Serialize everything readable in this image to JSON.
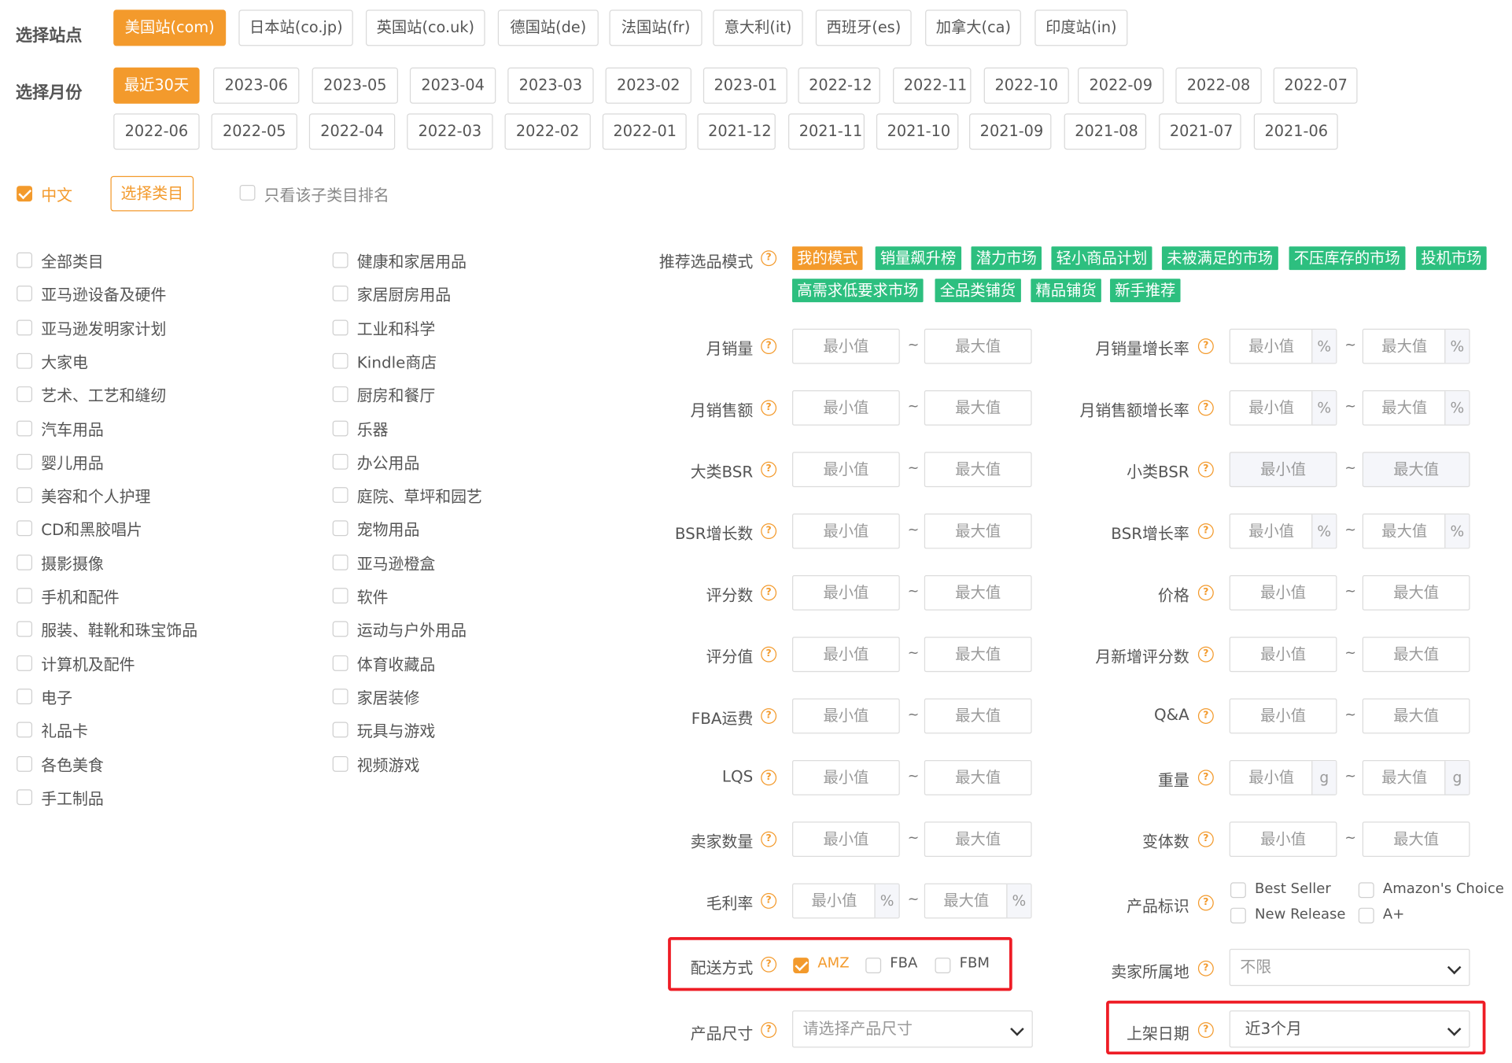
{
  "site": {
    "label": "选择站点",
    "options": [
      "美国站(com)",
      "日本站(co.jp)",
      "英国站(co.uk)",
      "德国站(de)",
      "法国站(fr)",
      "意大利(it)",
      "西班牙(es)",
      "加拿大(ca)",
      "印度站(in)"
    ],
    "selected": "美国站(com)"
  },
  "month": {
    "label": "选择月份",
    "row1": [
      "最近30天",
      "2023-06",
      "2023-05",
      "2023-04",
      "2023-03",
      "2023-02",
      "2023-01",
      "2022-12",
      "2022-11",
      "2022-10",
      "2022-09",
      "2022-08",
      "2022-07"
    ],
    "row2": [
      "2022-06",
      "2022-05",
      "2022-04",
      "2022-03",
      "2022-02",
      "2022-01",
      "2021-12",
      "2021-11",
      "2021-10",
      "2021-09",
      "2021-08",
      "2021-07",
      "2021-06"
    ],
    "selected": "最近30天"
  },
  "options_row": {
    "chinese_label": "中文",
    "chinese_checked": true,
    "select_category_button": "选择类目",
    "only_subcategory_label": "只看该子类目排名",
    "only_subcategory_checked": false
  },
  "categories": {
    "col1": [
      "全部类目",
      "亚马逊设备及硬件",
      "亚马逊发明家计划",
      "大家电",
      "艺术、工艺和缝纫",
      "汽车用品",
      "婴儿用品",
      "美容和个人护理",
      "CD和黑胶唱片",
      "摄影摄像",
      "手机和配件",
      "服装、鞋靴和珠宝饰品",
      "计算机及配件",
      "电子",
      "礼品卡",
      "各色美食",
      "手工制品"
    ],
    "col2": [
      "健康和家居用品",
      "家居厨房用品",
      "工业和科学",
      "Kindle商店",
      "厨房和餐厅",
      "乐器",
      "办公用品",
      "庭院、草坪和园艺",
      "宠物用品",
      "亚马逊橙盒",
      "软件",
      "运动与户外用品",
      "体育收藏品",
      "家居装修",
      "玩具与游戏",
      "视频游戏"
    ]
  },
  "recommend": {
    "label": "推荐选品模式",
    "tags_row1": [
      "我的模式",
      "销量飙升榜",
      "潜力市场",
      "轻小商品计划",
      "未被满足的市场",
      "不压库存的市场",
      "投机市场"
    ],
    "tags_row2": [
      "高需求低要求市场",
      "全品类铺货",
      "精品铺货",
      "新手推荐"
    ],
    "active_tag": "我的模式",
    "colors": {
      "active": "#f39a2c",
      "tag": "#2dbf7f"
    }
  },
  "placeholders": {
    "min": "最小值",
    "max": "最大值",
    "tilde": "~"
  },
  "filters_left": [
    {
      "label": "月销量",
      "unit": ""
    },
    {
      "label": "月销售额",
      "unit": ""
    },
    {
      "label": "大类BSR",
      "unit": ""
    },
    {
      "label": "BSR增长数",
      "unit": ""
    },
    {
      "label": "评分数",
      "unit": ""
    },
    {
      "label": "评分值",
      "unit": ""
    },
    {
      "label": "FBA运费",
      "unit": ""
    },
    {
      "label": "LQS",
      "unit": ""
    },
    {
      "label": "卖家数量",
      "unit": ""
    },
    {
      "label": "毛利率",
      "unit": "%"
    }
  ],
  "filters_right": [
    {
      "label": "月销量增长率",
      "unit": "%"
    },
    {
      "label": "月销售额增长率",
      "unit": "%"
    },
    {
      "label": "小类BSR",
      "unit": ""
    },
    {
      "label": "BSR增长率",
      "unit": "%"
    },
    {
      "label": "价格",
      "unit": ""
    },
    {
      "label": "月新增评分数",
      "unit": ""
    },
    {
      "label": "Q&A",
      "unit": ""
    },
    {
      "label": "重量",
      "unit": "g"
    },
    {
      "label": "变体数",
      "unit": ""
    }
  ],
  "product_badge": {
    "label": "产品标识",
    "options": [
      {
        "label": "Best Seller",
        "checked": false
      },
      {
        "label": "Amazon's Choice",
        "checked": false
      },
      {
        "label": "New Release",
        "checked": false
      },
      {
        "label": "A+",
        "checked": false
      }
    ]
  },
  "shipping": {
    "label": "配送方式",
    "options": [
      {
        "label": "AMZ",
        "checked": true
      },
      {
        "label": "FBA",
        "checked": false
      },
      {
        "label": "FBM",
        "checked": false
      }
    ]
  },
  "seller_location": {
    "label": "卖家所属地",
    "value": "不限"
  },
  "product_size": {
    "label": "产品尺寸",
    "placeholder": "请选择产品尺寸"
  },
  "listing_date": {
    "label": "上架日期",
    "value": "近3个月"
  },
  "help_glyph": "?",
  "highlight_color": "#ee1c25"
}
